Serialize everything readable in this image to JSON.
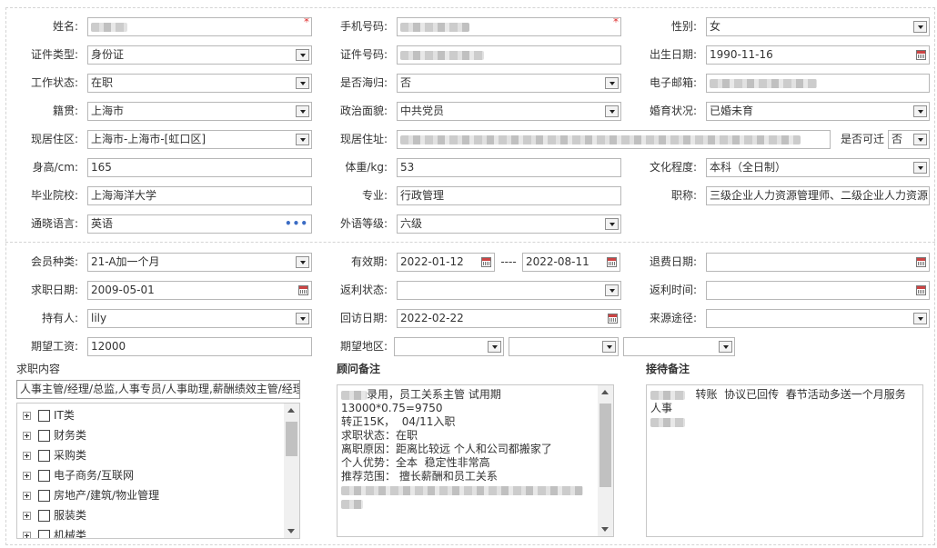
{
  "personal": {
    "name": {
      "label": "姓名:"
    },
    "phone": {
      "label": "手机号码:"
    },
    "gender": {
      "label": "性别:",
      "value": "女"
    },
    "id_type": {
      "label": "证件类型:",
      "value": "身份证"
    },
    "id_number": {
      "label": "证件号码:"
    },
    "birth_date": {
      "label": "出生日期:",
      "value": "1990-11-16"
    },
    "work_status": {
      "label": "工作状态:",
      "value": "在职"
    },
    "returnee": {
      "label": "是否海归:",
      "value": "否"
    },
    "email": {
      "label": "电子邮箱:"
    },
    "native_place": {
      "label": "籍贯:",
      "value": "上海市"
    },
    "political_status": {
      "label": "政治面貌:",
      "value": "中共党员"
    },
    "marital_status": {
      "label": "婚育状况:",
      "value": "已婚未育"
    },
    "current_area": {
      "label": "现居住区:",
      "value": "上海市-上海市-[虹口区]"
    },
    "current_address": {
      "label": "现居住址:"
    },
    "relocatable": {
      "label": "是否可迁",
      "value": "否"
    },
    "height": {
      "label": "身高/cm:",
      "value": "165"
    },
    "weight": {
      "label": "体重/kg:",
      "value": "53"
    },
    "education": {
      "label": "文化程度:",
      "value": "本科（全日制）"
    },
    "school": {
      "label": "毕业院校:",
      "value": "上海海洋大学"
    },
    "major": {
      "label": "专业:",
      "value": "行政管理"
    },
    "title": {
      "label": "职称:",
      "value": "三级企业人力资源管理师、二级企业人力资源"
    },
    "language": {
      "label": "通晓语言:",
      "value": "英语",
      "more": "•••"
    },
    "language_level": {
      "label": "外语等级:",
      "value": "六级"
    }
  },
  "membership": {
    "member_type": {
      "label": "会员种类:",
      "value": "21-A加一个月"
    },
    "valid_period": {
      "label": "有效期:",
      "start": "2022-01-12",
      "separator": "----",
      "end": "2022-08-11"
    },
    "refund_date": {
      "label": "退费日期:",
      "value": ""
    },
    "job_seek_date": {
      "label": "求职日期:",
      "value": "2009-05-01"
    },
    "rebate_status": {
      "label": "返利状态:",
      "value": ""
    },
    "rebate_time": {
      "label": "返利时间:",
      "value": ""
    },
    "holder": {
      "label": "持有人:",
      "value": "lily"
    },
    "visit_date": {
      "label": "回访日期:",
      "value": "2022-02-22"
    },
    "source": {
      "label": "来源途径:",
      "value": ""
    },
    "expected_salary": {
      "label": "期望工资:",
      "value": "12000"
    },
    "expected_region": {
      "label": "期望地区:"
    }
  },
  "job_content": {
    "label": "求职内容",
    "summary": "人事主管/经理/总监,人事专员/人事助理,薪酬绩效主管/经理",
    "tree": [
      "IT类",
      "财务类",
      "采购类",
      "电子商务/互联网",
      "房地产/建筑/物业管理",
      "服装类",
      "机械类"
    ]
  },
  "advisor_notes": {
    "label": "顾问备注",
    "lines": [
      "录用，员工关系主管 试用期13000*0.75=9750",
      "转正15K，  04/11入职",
      "",
      "",
      "求职状态：在职",
      "离职原因：距离比较远 个人和公司都搬家了",
      "个人优势：全本  稳定性非常高",
      "推荐范围： 擅长薪酬和员工关系"
    ]
  },
  "reception_notes": {
    "label": "接待备注",
    "line1": "转账  协议已回传  春节活动多送一个月服务",
    "line2": "人事"
  },
  "required_mark": "*"
}
